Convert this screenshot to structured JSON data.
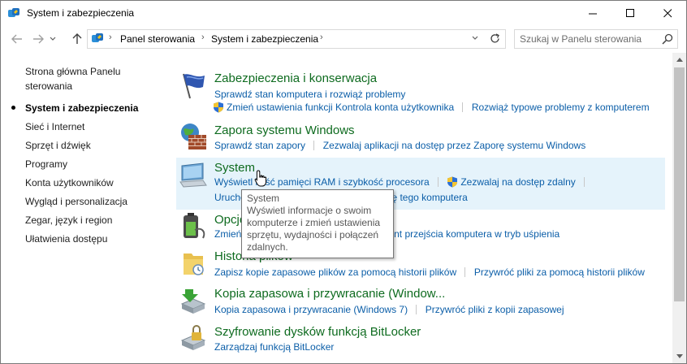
{
  "window": {
    "title": "System i zabezpieczenia"
  },
  "address": {
    "crumbs": [
      "Panel sterowania",
      "System i zabezpieczenia"
    ]
  },
  "search": {
    "placeholder": "Szukaj w Panelu sterowania"
  },
  "leftnav": {
    "items": [
      {
        "label": "Strona główna Panelu",
        "label2": "sterowania",
        "active": false
      },
      {
        "label": "System i zabezpieczenia",
        "active": true
      },
      {
        "label": "Sieć i Internet",
        "active": false
      },
      {
        "label": "Sprzęt i dźwięk",
        "active": false
      },
      {
        "label": "Programy",
        "active": false
      },
      {
        "label": "Konta użytkowników",
        "active": false
      },
      {
        "label": "Wygląd i personalizacja",
        "active": false
      },
      {
        "label": "Zegar, język i region",
        "active": false
      },
      {
        "label": "Ułatwienia dostępu",
        "active": false
      }
    ]
  },
  "categories": [
    {
      "title": "Zabezpieczenia i konserwacja",
      "row1": [
        "Sprawdź stan komputera i rozwiąż problemy"
      ],
      "row2": [
        "Zmień ustawienia funkcji Kontrola konta użytkownika",
        "Rozwiąż typowe problemy z komputerem"
      ]
    },
    {
      "title": "Zapora systemu Windows",
      "row1": [
        "Sprawdź stan zapory",
        "Zezwalaj aplikacji na dostęp przez Zaporę systemu Windows"
      ]
    },
    {
      "title": "System",
      "row1": [
        "Wyświetl ilość pamięci RAM i szybkość procesora",
        "Zezwalaj na dostęp zdalny"
      ],
      "row2": [
        "Uruchom Asystę zdalną",
        "Zobacz nazwę tego komputera"
      ]
    },
    {
      "title": "Opcje zasilania",
      "row1": [
        "Zmień ustawienia baterii",
        "Zmień moment przejścia komputera w tryb uśpienia"
      ]
    },
    {
      "title": "Historia plików",
      "row1": [
        "Zapisz kopie zapasowe plików za pomocą historii plików",
        "Przywróć pliki za pomocą historii plików"
      ]
    },
    {
      "title": "Kopia zapasowa i przywracanie (Window...",
      "row1": [
        "Kopia zapasowa i przywracanie (Windows 7)",
        "Przywróć pliki z kopii zapasowej"
      ]
    },
    {
      "title": "Szyfrowanie dysków funkcją BitLocker",
      "row1": [
        "Zarządzaj funkcją BitLocker"
      ]
    }
  ],
  "tooltip": {
    "title": "System",
    "body": "Wyświetl informacje o swoim komputerze i zmień ustawienia sprzętu, wydajności i połączeń zdalnych."
  }
}
